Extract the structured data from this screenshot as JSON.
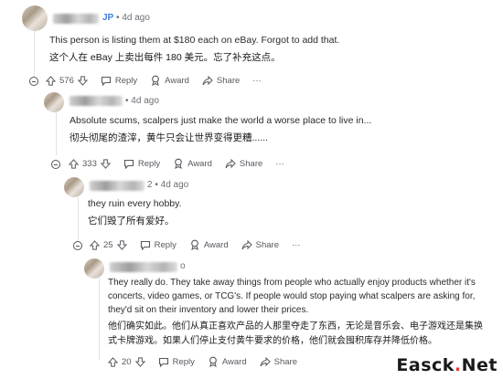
{
  "comments": [
    {
      "flair": "JP",
      "time": "4d ago",
      "text_en": "This person is listing them at $180 each on eBay. Forgot to add that.",
      "text_cn": "这个人在 eBay 上卖出每件 180 美元。忘了补充这点。",
      "votes": "576"
    },
    {
      "time": "4d ago",
      "text_en": "Absolute scums, scalpers just make the world a worse place to live in...",
      "text_cn": "彻头彻尾的渣滓，黄牛只会让世界变得更糟......",
      "votes": "333"
    },
    {
      "name_tail": "2",
      "time": "4d ago",
      "text_en": "they ruin every hobby.",
      "text_cn": "它们毁了所有爱好。",
      "votes": "25"
    },
    {
      "name_tail": "o",
      "text_en": "They really do. They take away things from people who actually enjoy products whether it's concerts, video games, or TCG's. If people would stop paying what scalpers are asking for, they'd sit on their inventory and lower their prices.",
      "text_cn": "他们确实如此。他们从真正喜欢产品的人那里夺走了东西，无论是音乐会、电子游戏还是集换式卡牌游戏。如果人们停止支付黄牛要求的价格，他们就会囤积库存并降低价格。",
      "votes": "20"
    }
  ],
  "actions": {
    "reply": "Reply",
    "award": "Award",
    "share": "Share",
    "more": "···"
  },
  "separator": "•",
  "watermark": {
    "part1": "Easck",
    "dot": ".",
    "part2": "Net"
  },
  "colors": {
    "flair": "#3d7de0",
    "watermark_dot": "#e23b2f"
  },
  "icons": [
    "upvote-icon",
    "downvote-icon",
    "reply-icon",
    "award-icon",
    "share-icon",
    "collapse-icon"
  ]
}
